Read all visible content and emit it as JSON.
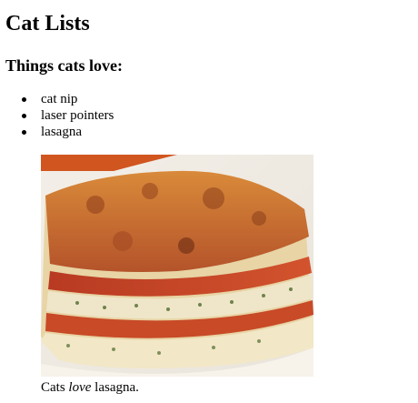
{
  "page": {
    "title": "Cat Lists",
    "subtitle": "Things cats love:",
    "items": [
      {
        "label": "cat nip"
      },
      {
        "label": "laser pointers"
      },
      {
        "label": "lasagna"
      }
    ],
    "caption": {
      "before": "Cats ",
      "emphasis": "love",
      "after": " lasagna."
    }
  }
}
